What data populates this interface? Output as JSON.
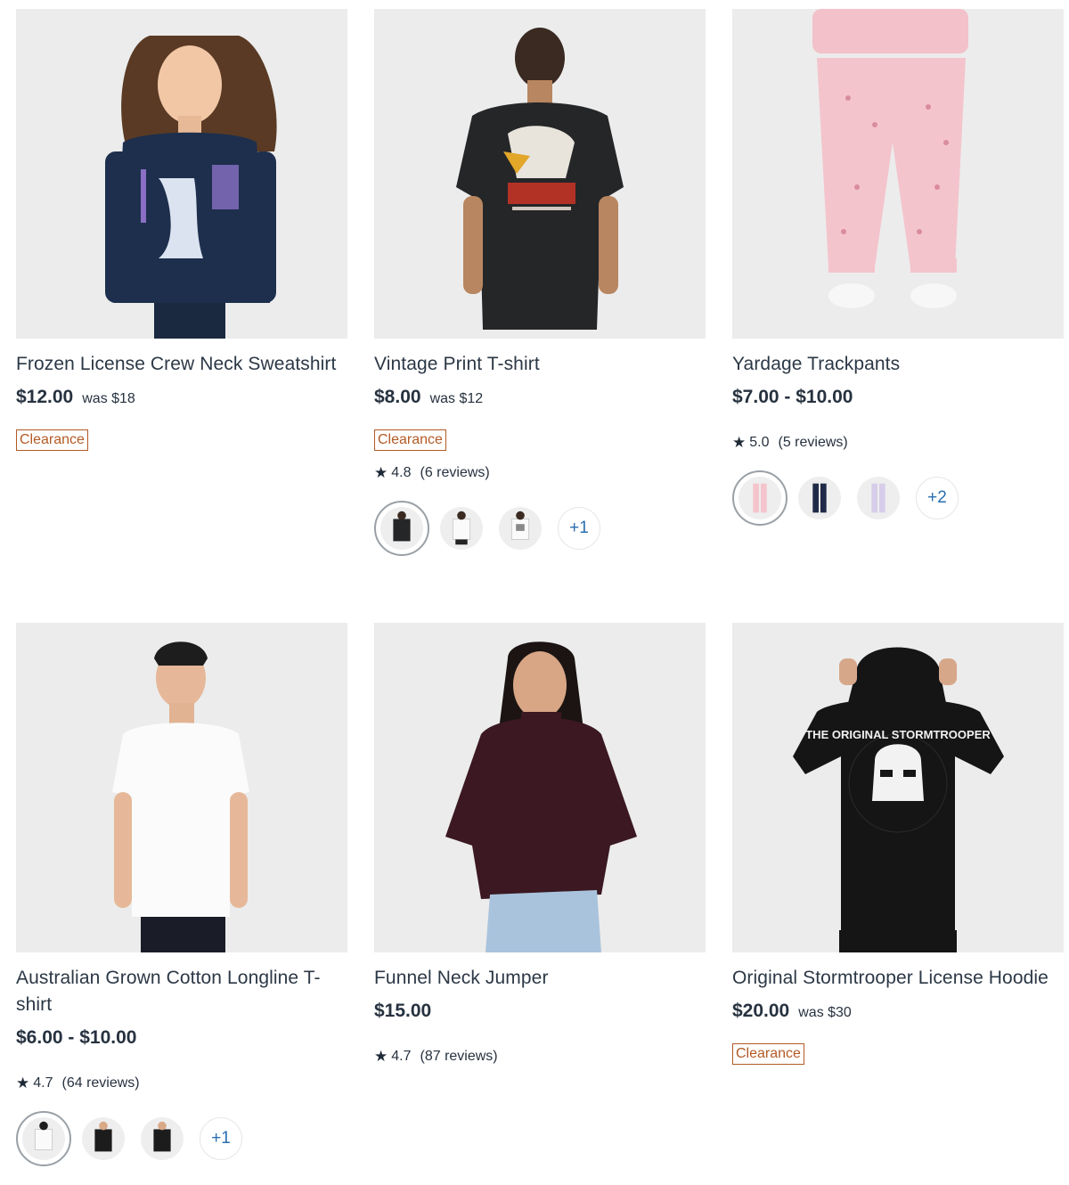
{
  "products": [
    {
      "title": "Frozen License Crew Neck Sweatshirt",
      "price": "$12.00",
      "was": "was $18",
      "badge": "Clearance"
    },
    {
      "title": "Vintage Print T-shirt",
      "price": "$8.00",
      "was": "was $12",
      "badge": "Clearance",
      "rating": "4.8",
      "reviews": "(6 reviews)",
      "more_colours": "+1"
    },
    {
      "title": "Yardage Trackpants",
      "price": "$7.00 - $10.00",
      "rating": "5.0",
      "reviews": "(5 reviews)",
      "more_colours": "+2"
    },
    {
      "title": "Australian Grown Cotton Longline T-shirt",
      "price": "$6.00 - $10.00",
      "rating": "4.7",
      "reviews": "(64 reviews)",
      "more_colours": "+1"
    },
    {
      "title": "Funnel Neck Jumper",
      "price": "$15.00",
      "rating": "4.7",
      "reviews": "(87 reviews)"
    },
    {
      "title": "Original Stormtrooper License Hoodie",
      "price": "$20.00",
      "was": "was $30",
      "badge": "Clearance",
      "print_text": "THE ORIGINAL STORMTROOPER"
    }
  ],
  "star_glyph": "★",
  "colors": {
    "text": "#273240",
    "clearance": "#b35a24",
    "swatch_more": "#2a6fb0",
    "image_bg": "#ececec"
  }
}
